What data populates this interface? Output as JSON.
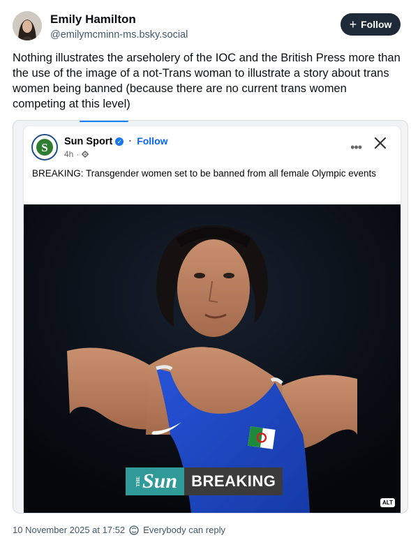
{
  "post": {
    "display_name": "Emily Hamilton",
    "handle": "@emilymcminn-ms.bsky.social",
    "follow_label": "Follow",
    "text": "Nothing illustrates the arseholery of the IOC and the British Press more than the use of the image of a not-Trans woman to illustrate a story about trans women being banned (because there are no current trans women competing at this level)",
    "timestamp": "10 November 2025 at 17:52",
    "reply_setting": "Everybody can reply"
  },
  "embed": {
    "page_name": "Sun Sport",
    "separator": "·",
    "follow_label": "Follow",
    "time": "4h",
    "time_separator": "·",
    "text": "BREAKING: Transgender women set to be banned from all female Olympic events",
    "photo": {
      "logo_small": "THE",
      "logo_text": "Sun",
      "banner_text": "BREAKING",
      "alt_badge": "ALT"
    }
  },
  "icons": {
    "verified": "verified-check-icon",
    "globe": "gear-globe-icon",
    "more": "more-dots-icon",
    "close": "close-icon",
    "reply": "reply-globe-icon"
  },
  "colors": {
    "follow_button_bg": "#1e2a38",
    "fb_blue": "#0866ff",
    "accent": "#1083fe",
    "vest_blue": "#1c46c4",
    "banner_teal": "#2f9a97"
  }
}
